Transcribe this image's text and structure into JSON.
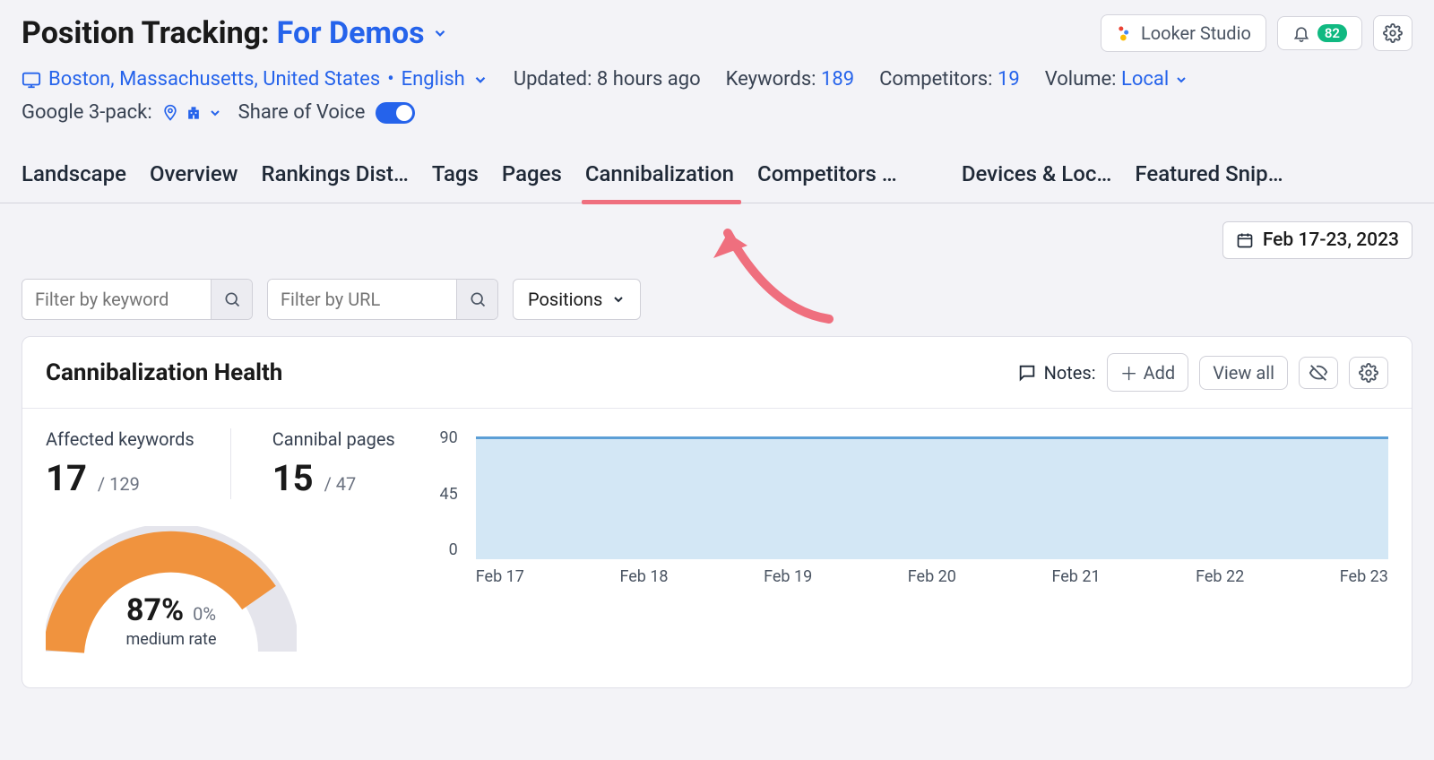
{
  "header": {
    "title_prefix": "Position Tracking:",
    "project": "For Demos",
    "looker_label": "Looker Studio",
    "bell_badge": "82",
    "location": "Boston, Massachusetts, United States",
    "language": "English",
    "updated_label": "Updated:",
    "updated_value": "8 hours ago",
    "keywords_label": "Keywords:",
    "keywords_value": "189",
    "competitors_label": "Competitors:",
    "competitors_value": "19",
    "volume_label": "Volume:",
    "volume_value": "Local",
    "g3p_label": "Google 3-pack:",
    "sov_label": "Share of Voice"
  },
  "tabs": {
    "items": [
      "Landscape",
      "Overview",
      "Rankings Dist…",
      "Tags",
      "Pages",
      "Cannibalization",
      "Competitors …",
      "Devices & Loc…",
      "Featured Snip…"
    ],
    "active_index": 5
  },
  "toolbar": {
    "filter_keyword_placeholder": "Filter by keyword",
    "filter_url_placeholder": "Filter by URL",
    "positions_label": "Positions",
    "date_label": "Feb 17-23, 2023"
  },
  "card": {
    "title": "Cannibalization Health",
    "notes_label": "Notes:",
    "add_label": "Add",
    "viewall_label": "View all",
    "affected_label": "Affected keywords",
    "affected_value": "17",
    "affected_total": "/ 129",
    "cannibal_label": "Cannibal pages",
    "cannibal_value": "15",
    "cannibal_total": "/ 47",
    "gauge_pct": "87%",
    "gauge_delta": "0%",
    "gauge_sub": "medium rate"
  },
  "chart_data": {
    "type": "area",
    "title": "",
    "xlabel": "",
    "ylabel": "",
    "ylim": [
      0,
      90
    ],
    "yticks": [
      0,
      45,
      90
    ],
    "categories": [
      "Feb 17",
      "Feb 18",
      "Feb 19",
      "Feb 20",
      "Feb 21",
      "Feb 22",
      "Feb 23"
    ],
    "series": [
      {
        "name": "health",
        "values": [
          87,
          87,
          87,
          87,
          87,
          87,
          87
        ]
      }
    ]
  }
}
